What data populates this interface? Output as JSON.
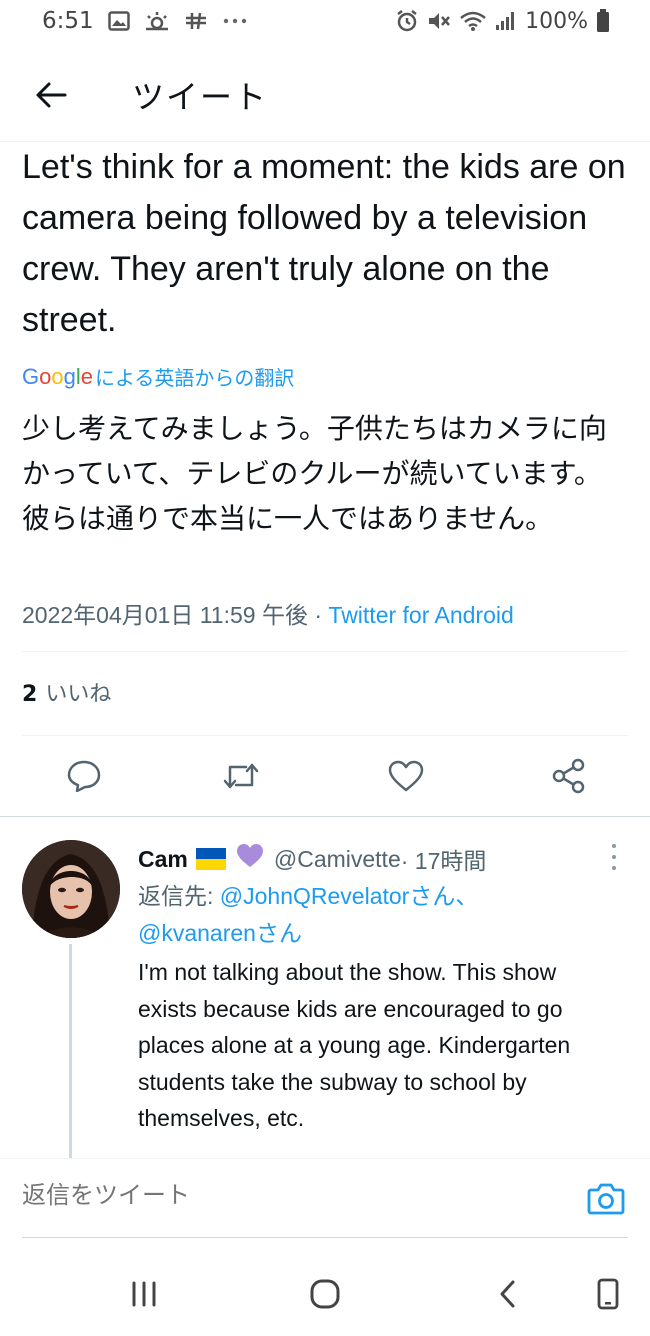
{
  "status_bar": {
    "time": "6:51",
    "battery": "100%"
  },
  "header": {
    "title": "ツイート"
  },
  "tweet": {
    "text": "Let's think for a moment: the kids are on camera being followed by a television crew. They aren't truly alone on the street.",
    "translation_credit": "による英語からの翻訳",
    "translated_text": "少し考えてみましょう。子供たちはカメラに向かっていて、テレビのクルーが続いています。彼らは通りで本当に一人ではありません。",
    "timestamp": "2022年04月01日 11:59 午後",
    "separator": " · ",
    "source": "Twitter for Android",
    "like_count": "2",
    "like_label": "いいね"
  },
  "reply": {
    "name": "Cam",
    "handle": "@Camivette",
    "time": " · 17時間",
    "reply_to_prefix": "返信先: ",
    "mention_1": "@JohnQRevelatorさん",
    "mention_sep": "、",
    "mention_2": "@kvanarenさん",
    "text": "I'm not talking about the show. This show exists because kids are encouraged to go places alone at a young age. Kindergarten students take the subway to school by themselves, etc."
  },
  "compose": {
    "placeholder": "返信をツイート"
  },
  "colors": {
    "accent": "#1d9bf0",
    "secondary_text": "#536471",
    "primary_text": "#0f1419",
    "divider": "#eff3f4"
  }
}
